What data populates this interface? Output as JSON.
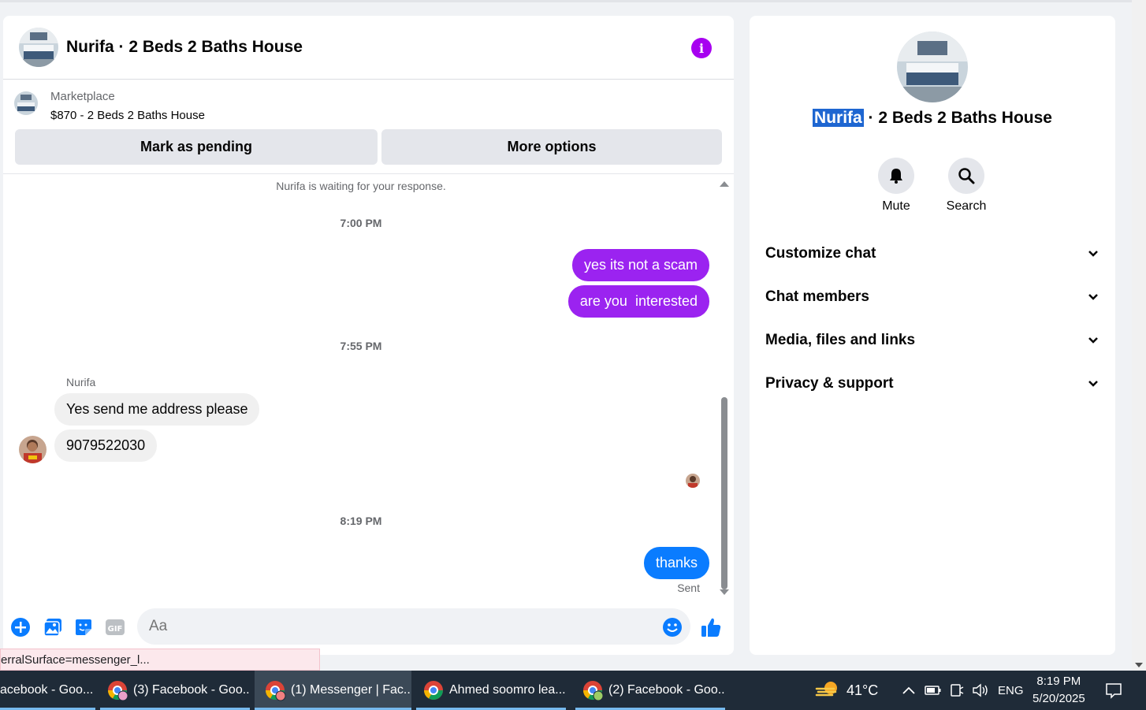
{
  "chat": {
    "title": "Nurifa · 2 Beds 2 Baths House",
    "listing_source": "Marketplace",
    "listing_price_title": "$870 - 2 Beds 2 Baths House",
    "mark_pending_label": "Mark as pending",
    "more_options_label": "More options",
    "waiting_note": "Nurifa is waiting for your response.",
    "messages": [
      {
        "kind": "time",
        "text": "7:00 PM"
      },
      {
        "kind": "out",
        "text": "yes its not a scam"
      },
      {
        "kind": "out",
        "text": "are you  interested"
      },
      {
        "kind": "time",
        "text": "7:55 PM"
      },
      {
        "kind": "sender",
        "text": "Nurifa"
      },
      {
        "kind": "in",
        "text": "Yes send me address please"
      },
      {
        "kind": "in",
        "text": "9079522030"
      },
      {
        "kind": "time",
        "text": "8:19 PM"
      },
      {
        "kind": "out",
        "text": "thanks"
      },
      {
        "kind": "status",
        "text": "Sent"
      }
    ],
    "composer_placeholder": "Aa"
  },
  "sidebar": {
    "title_highlight": "Nurifa",
    "title_rest": " · 2 Beds 2 Baths House",
    "mute_label": "Mute",
    "search_label": "Search",
    "sections": [
      "Customize chat",
      "Chat members",
      "Media, files and links",
      "Privacy & support"
    ]
  },
  "status_bar_url": "erralSurface=messenger_l...",
  "taskbar": {
    "tasks": [
      "acebook - Goo...",
      "(3) Facebook - Goo...",
      "(1) Messenger | Fac...",
      "Ahmed soomro lea...",
      "(2) Facebook - Goo..."
    ],
    "weather": "41°C",
    "language": "ENG",
    "time": "8:19 PM",
    "date": "5/20/2025"
  },
  "colors": {
    "accent_purple": "#9b23f0",
    "accent_blue": "#0a7cff",
    "info_purple": "#a700f0"
  }
}
